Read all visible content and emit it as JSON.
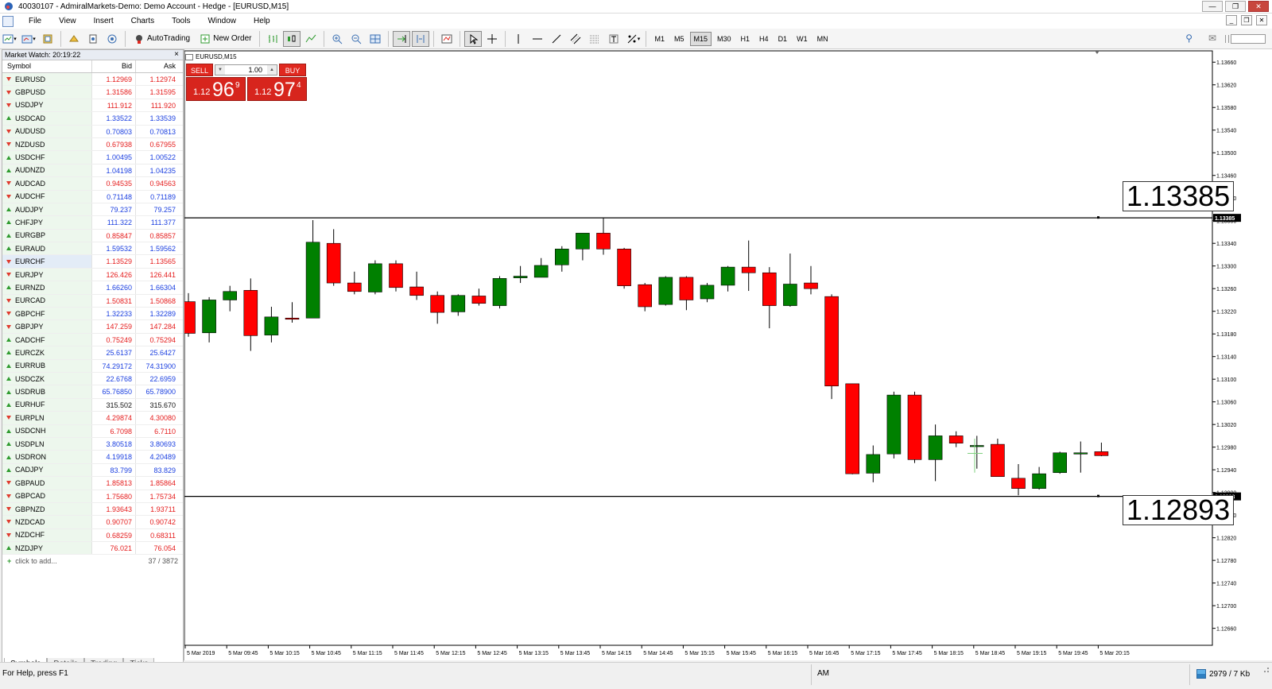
{
  "window": {
    "title": "40030107 - AdmiralMarkets-Demo: Demo Account - Hedge - [EURUSD,M15]",
    "buttons": [
      "—",
      "❐",
      "✕"
    ]
  },
  "menu": [
    "File",
    "View",
    "Insert",
    "Charts",
    "Tools",
    "Window",
    "Help"
  ],
  "toolbar": {
    "autotrading": "AutoTrading",
    "new_order": "New Order",
    "timeframes": [
      "M1",
      "M5",
      "M15",
      "M30",
      "H1",
      "H4",
      "D1",
      "W1",
      "MN"
    ],
    "active_timeframe": "M15"
  },
  "market_watch": {
    "title": "Market Watch: 20:19:22",
    "columns": {
      "symbol": "Symbol",
      "bid": "Bid",
      "ask": "Ask"
    },
    "rows": [
      {
        "symbol": "EURUSD",
        "bid": "1.12969",
        "ask": "1.12974",
        "dir": "down",
        "color": "red"
      },
      {
        "symbol": "GBPUSD",
        "bid": "1.31586",
        "ask": "1.31595",
        "dir": "down",
        "color": "red"
      },
      {
        "symbol": "USDJPY",
        "bid": "111.912",
        "ask": "111.920",
        "dir": "down",
        "color": "red"
      },
      {
        "symbol": "USDCAD",
        "bid": "1.33522",
        "ask": "1.33539",
        "dir": "up",
        "color": "blue"
      },
      {
        "symbol": "AUDUSD",
        "bid": "0.70803",
        "ask": "0.70813",
        "dir": "down",
        "color": "blue"
      },
      {
        "symbol": "NZDUSD",
        "bid": "0.67938",
        "ask": "0.67955",
        "dir": "down",
        "color": "red"
      },
      {
        "symbol": "USDCHF",
        "bid": "1.00495",
        "ask": "1.00522",
        "dir": "up",
        "color": "blue"
      },
      {
        "symbol": "AUDNZD",
        "bid": "1.04198",
        "ask": "1.04235",
        "dir": "up",
        "color": "blue"
      },
      {
        "symbol": "AUDCAD",
        "bid": "0.94535",
        "ask": "0.94563",
        "dir": "down",
        "color": "red"
      },
      {
        "symbol": "AUDCHF",
        "bid": "0.71148",
        "ask": "0.71189",
        "dir": "down",
        "color": "blue"
      },
      {
        "symbol": "AUDJPY",
        "bid": "79.237",
        "ask": "79.257",
        "dir": "up",
        "color": "blue"
      },
      {
        "symbol": "CHFJPY",
        "bid": "111.322",
        "ask": "111.377",
        "dir": "up",
        "color": "blue"
      },
      {
        "symbol": "EURGBP",
        "bid": "0.85847",
        "ask": "0.85857",
        "dir": "up",
        "color": "red"
      },
      {
        "symbol": "EURAUD",
        "bid": "1.59532",
        "ask": "1.59562",
        "dir": "up",
        "color": "blue"
      },
      {
        "symbol": "EURCHF",
        "bid": "1.13529",
        "ask": "1.13565",
        "dir": "down",
        "color": "red"
      },
      {
        "symbol": "EURJPY",
        "bid": "126.426",
        "ask": "126.441",
        "dir": "down",
        "color": "red"
      },
      {
        "symbol": "EURNZD",
        "bid": "1.66260",
        "ask": "1.66304",
        "dir": "up",
        "color": "blue"
      },
      {
        "symbol": "EURCAD",
        "bid": "1.50831",
        "ask": "1.50868",
        "dir": "down",
        "color": "red"
      },
      {
        "symbol": "GBPCHF",
        "bid": "1.32233",
        "ask": "1.32289",
        "dir": "down",
        "color": "blue"
      },
      {
        "symbol": "GBPJPY",
        "bid": "147.259",
        "ask": "147.284",
        "dir": "down",
        "color": "red"
      },
      {
        "symbol": "CADCHF",
        "bid": "0.75249",
        "ask": "0.75294",
        "dir": "up",
        "color": "red"
      },
      {
        "symbol": "EURCZK",
        "bid": "25.6137",
        "ask": "25.6427",
        "dir": "up",
        "color": "blue"
      },
      {
        "symbol": "EURRUB",
        "bid": "74.29172",
        "ask": "74.31900",
        "dir": "up",
        "color": "blue"
      },
      {
        "symbol": "USDCZK",
        "bid": "22.6768",
        "ask": "22.6959",
        "dir": "up",
        "color": "blue"
      },
      {
        "symbol": "USDRUB",
        "bid": "65.76850",
        "ask": "65.78900",
        "dir": "up",
        "color": "blue"
      },
      {
        "symbol": "EURHUF",
        "bid": "315.502",
        "ask": "315.670",
        "dir": "up",
        "color": "black"
      },
      {
        "symbol": "EURPLN",
        "bid": "4.29874",
        "ask": "4.30080",
        "dir": "down",
        "color": "red"
      },
      {
        "symbol": "USDCNH",
        "bid": "6.7098",
        "ask": "6.7110",
        "dir": "up",
        "color": "red"
      },
      {
        "symbol": "USDPLN",
        "bid": "3.80518",
        "ask": "3.80693",
        "dir": "up",
        "color": "blue"
      },
      {
        "symbol": "USDRON",
        "bid": "4.19918",
        "ask": "4.20489",
        "dir": "up",
        "color": "blue"
      },
      {
        "symbol": "CADJPY",
        "bid": "83.799",
        "ask": "83.829",
        "dir": "up",
        "color": "blue"
      },
      {
        "symbol": "GBPAUD",
        "bid": "1.85813",
        "ask": "1.85864",
        "dir": "down",
        "color": "red"
      },
      {
        "symbol": "GBPCAD",
        "bid": "1.75680",
        "ask": "1.75734",
        "dir": "down",
        "color": "red"
      },
      {
        "symbol": "GBPNZD",
        "bid": "1.93643",
        "ask": "1.93711",
        "dir": "down",
        "color": "red"
      },
      {
        "symbol": "NZDCAD",
        "bid": "0.90707",
        "ask": "0.90742",
        "dir": "down",
        "color": "red"
      },
      {
        "symbol": "NZDCHF",
        "bid": "0.68259",
        "ask": "0.68311",
        "dir": "down",
        "color": "red"
      },
      {
        "symbol": "NZDJPY",
        "bid": "76.021",
        "ask": "76.054",
        "dir": "up",
        "color": "red"
      }
    ],
    "add_label": "click to add...",
    "count": "37 / 3872",
    "tabs": [
      "Symbols",
      "Details",
      "Trading",
      "Ticks"
    ],
    "active_tab": "Symbols"
  },
  "chart": {
    "tab_label": "EURUSD,M15",
    "one_click": {
      "sell": "SELL",
      "buy": "BUY",
      "lot": "1.00",
      "bid_prefix": "1.12",
      "bid_big": "96",
      "bid_pip": "9",
      "ask_prefix": "1.12",
      "ask_big": "97",
      "ask_pip": "4"
    },
    "hline_upper_label": "1.13385",
    "hline_lower_label": "1.12893"
  },
  "chart_data": {
    "type": "candlestick",
    "symbol": "EURUSD",
    "timeframe": "M15",
    "ylim": [
      1.1263,
      1.1368
    ],
    "y_ticks": [
      "1.13660",
      "1.13620",
      "1.13580",
      "1.13540",
      "1.13500",
      "1.13460",
      "1.13420",
      "1.13380",
      "1.13340",
      "1.13300",
      "1.13260",
      "1.13220",
      "1.13180",
      "1.13140",
      "1.13100",
      "1.13060",
      "1.13020",
      "1.12980",
      "1.12940",
      "1.12900",
      "1.12860",
      "1.12820",
      "1.12780",
      "1.12740",
      "1.12700",
      "1.12660"
    ],
    "x_ticks": [
      "5 Mar 2019",
      "5 Mar 09:45",
      "5 Mar 10:15",
      "5 Mar 10:45",
      "5 Mar 11:15",
      "5 Mar 11:45",
      "5 Mar 12:15",
      "5 Mar 12:45",
      "5 Mar 13:15",
      "5 Mar 13:45",
      "5 Mar 14:15",
      "5 Mar 14:45",
      "5 Mar 15:15",
      "5 Mar 15:45",
      "5 Mar 16:15",
      "5 Mar 16:45",
      "5 Mar 17:15",
      "5 Mar 17:45",
      "5 Mar 18:15",
      "5 Mar 18:45",
      "5 Mar 19:15",
      "5 Mar 19:45",
      "5 Mar 20:15"
    ],
    "hlines": [
      1.13385,
      1.12893
    ],
    "bid_marker": "1.12893",
    "upper_marker": "1.13385",
    "candles": [
      {
        "o": 1.13237,
        "h": 1.13252,
        "l": 1.13175,
        "c": 1.13181
      },
      {
        "o": 1.13182,
        "h": 1.13245,
        "l": 1.13165,
        "c": 1.1324
      },
      {
        "o": 1.1324,
        "h": 1.13265,
        "l": 1.1322,
        "c": 1.13255
      },
      {
        "o": 1.13257,
        "h": 1.13278,
        "l": 1.1315,
        "c": 1.13177
      },
      {
        "o": 1.13178,
        "h": 1.13228,
        "l": 1.13165,
        "c": 1.1321
      },
      {
        "o": 1.13208,
        "h": 1.13236,
        "l": 1.132,
        "c": 1.13206
      },
      {
        "o": 1.13208,
        "h": 1.13381,
        "l": 1.13208,
        "c": 1.13342
      },
      {
        "o": 1.1334,
        "h": 1.13365,
        "l": 1.13265,
        "c": 1.1327
      },
      {
        "o": 1.1327,
        "h": 1.1329,
        "l": 1.1325,
        "c": 1.13255
      },
      {
        "o": 1.13254,
        "h": 1.1331,
        "l": 1.1325,
        "c": 1.13304
      },
      {
        "o": 1.13304,
        "h": 1.1331,
        "l": 1.13255,
        "c": 1.13262
      },
      {
        "o": 1.13263,
        "h": 1.1329,
        "l": 1.1324,
        "c": 1.13248
      },
      {
        "o": 1.13248,
        "h": 1.13255,
        "l": 1.13198,
        "c": 1.13218
      },
      {
        "o": 1.13219,
        "h": 1.1325,
        "l": 1.13212,
        "c": 1.13248
      },
      {
        "o": 1.13247,
        "h": 1.1326,
        "l": 1.1323,
        "c": 1.13234
      },
      {
        "o": 1.1323,
        "h": 1.13282,
        "l": 1.13225,
        "c": 1.13278
      },
      {
        "o": 1.13279,
        "h": 1.133,
        "l": 1.1327,
        "c": 1.13282
      },
      {
        "o": 1.1328,
        "h": 1.13314,
        "l": 1.1328,
        "c": 1.13301
      },
      {
        "o": 1.13302,
        "h": 1.13335,
        "l": 1.1329,
        "c": 1.1333
      },
      {
        "o": 1.1333,
        "h": 1.13356,
        "l": 1.1331,
        "c": 1.13358
      },
      {
        "o": 1.13358,
        "h": 1.13385,
        "l": 1.1332,
        "c": 1.1333
      },
      {
        "o": 1.1333,
        "h": 1.13332,
        "l": 1.1326,
        "c": 1.13265
      },
      {
        "o": 1.13267,
        "h": 1.1327,
        "l": 1.1322,
        "c": 1.13228
      },
      {
        "o": 1.13232,
        "h": 1.13282,
        "l": 1.1323,
        "c": 1.1328
      },
      {
        "o": 1.1328,
        "h": 1.13282,
        "l": 1.13222,
        "c": 1.1324
      },
      {
        "o": 1.13242,
        "h": 1.1327,
        "l": 1.13236,
        "c": 1.13266
      },
      {
        "o": 1.13266,
        "h": 1.133,
        "l": 1.13255,
        "c": 1.13298
      },
      {
        "o": 1.13298,
        "h": 1.13345,
        "l": 1.13256,
        "c": 1.13288
      },
      {
        "o": 1.13288,
        "h": 1.13298,
        "l": 1.1319,
        "c": 1.1323
      },
      {
        "o": 1.1323,
        "h": 1.13322,
        "l": 1.13228,
        "c": 1.13268
      },
      {
        "o": 1.1327,
        "h": 1.133,
        "l": 1.1325,
        "c": 1.1326
      },
      {
        "o": 1.13246,
        "h": 1.1325,
        "l": 1.13065,
        "c": 1.13088
      },
      {
        "o": 1.13092,
        "h": 1.13092,
        "l": 1.12932,
        "c": 1.12933
      },
      {
        "o": 1.12934,
        "h": 1.12983,
        "l": 1.12918,
        "c": 1.12967
      },
      {
        "o": 1.12968,
        "h": 1.13078,
        "l": 1.1296,
        "c": 1.13072
      },
      {
        "o": 1.13072,
        "h": 1.13078,
        "l": 1.12952,
        "c": 1.12958
      },
      {
        "o": 1.12958,
        "h": 1.1302,
        "l": 1.1292,
        "c": 1.13
      },
      {
        "o": 1.13,
        "h": 1.13008,
        "l": 1.1298,
        "c": 1.12987
      },
      {
        "o": 1.12983,
        "h": 1.13,
        "l": 1.12942,
        "c": 1.12983
      },
      {
        "o": 1.12985,
        "h": 1.12995,
        "l": 1.1293,
        "c": 1.12928
      },
      {
        "o": 1.12925,
        "h": 1.1295,
        "l": 1.12895,
        "c": 1.12907
      },
      {
        "o": 1.12907,
        "h": 1.12945,
        "l": 1.12905,
        "c": 1.12933
      },
      {
        "o": 1.12935,
        "h": 1.12972,
        "l": 1.12933,
        "c": 1.1297
      },
      {
        "o": 1.12968,
        "h": 1.1299,
        "l": 1.12935,
        "c": 1.1297
      },
      {
        "o": 1.12972,
        "h": 1.12988,
        "l": 1.12964,
        "c": 1.12965
      }
    ]
  }
}
